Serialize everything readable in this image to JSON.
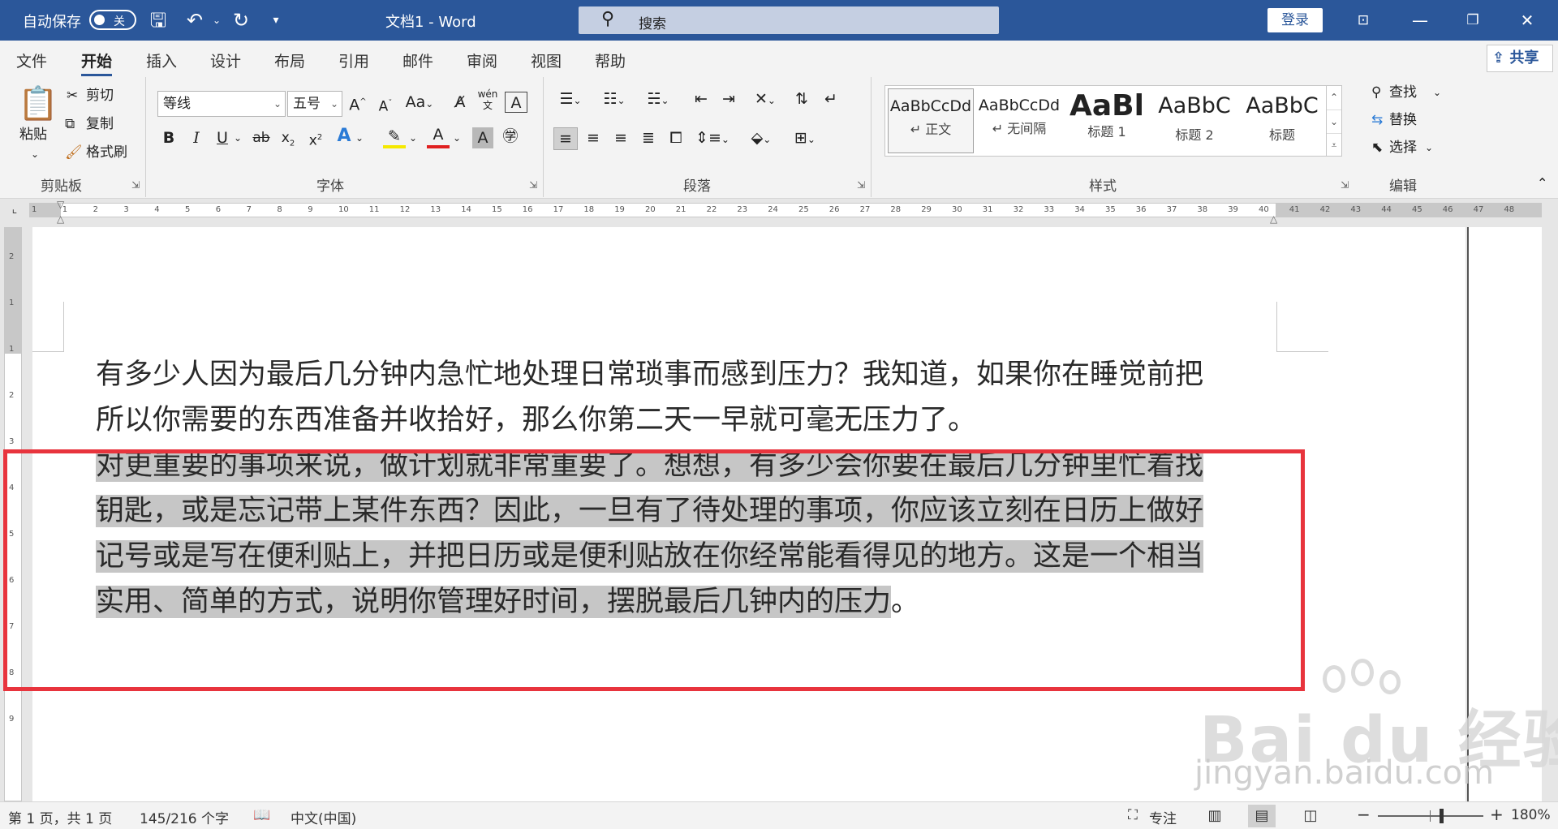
{
  "titlebar": {
    "autosave_label": "自动保存",
    "autosave_state": "关",
    "doc_title": "文档1  -  Word",
    "search_placeholder": "搜索",
    "login_label": "登录",
    "bg_color": "#2b579a"
  },
  "tabs": [
    "文件",
    "开始",
    "插入",
    "设计",
    "布局",
    "引用",
    "邮件",
    "审阅",
    "视图",
    "帮助"
  ],
  "active_tab": "开始",
  "share_label": "共享",
  "clipboard": {
    "paste": "粘贴",
    "cut": "剪切",
    "copy": "复制",
    "format_painter": "格式刷",
    "group": "剪贴板"
  },
  "font": {
    "name": "等线",
    "size": "五号",
    "group": "字体"
  },
  "paragraph": {
    "group": "段落"
  },
  "styles": {
    "group": "样式",
    "items": [
      {
        "preview": "AaBbCcDd",
        "name": "↵ 正文"
      },
      {
        "preview": "AaBbCcDd",
        "name": "↵ 无间隔"
      },
      {
        "preview": "AaBl",
        "name": "标题 1"
      },
      {
        "preview": "AaBbC",
        "name": "标题 2"
      },
      {
        "preview": "AaBbC",
        "name": "标题"
      }
    ]
  },
  "editing": {
    "find": "查找",
    "replace": "替换",
    "select": "选择",
    "group": "编辑"
  },
  "ruler_numbers": [
    1,
    1,
    2,
    3,
    4,
    5,
    6,
    7,
    8,
    9,
    10,
    11,
    12,
    13,
    14,
    15,
    16,
    17,
    18,
    19,
    20,
    21,
    22,
    23,
    24,
    25,
    26,
    27,
    28,
    29,
    30,
    31,
    32,
    33,
    34,
    35,
    36,
    37,
    38,
    39,
    40,
    41,
    42,
    43,
    44,
    45,
    46,
    47,
    48
  ],
  "vruler_numbers": [
    2,
    1,
    1,
    2,
    3,
    4,
    5,
    6,
    7,
    8,
    9
  ],
  "document": {
    "para1": [
      "有多少人因为最后几分钟内急忙地处理日常琐事而感到压力？我知道，如果你在睡觉前把",
      "所以你需要的东西准备并收拾好，那么你第二天一早就可毫无压力了。"
    ],
    "para2": [
      "对更重要的事项来说，做计划就非常重要了。想想，有多少会你要在最后几分钟里忙着找",
      "钥匙，或是忘记带上某件东西？因此，一旦有了待处理的事项，你应该立刻在日历上做好",
      "记号或是写在便利贴上，并把日历或是便利贴放在你经常能看得见的地方。这是一个相当",
      "实用、简单的方式，说明你管理好时间，摆脱最后几钟内的压力"
    ],
    "para2_end": "。",
    "highlight_color": "#c6c6c6",
    "annotation_color": "#e8343d"
  },
  "watermark": {
    "brand": "Bai  du 经验",
    "url": "jingyan.baidu.com"
  },
  "statusbar": {
    "page": "第 1 页，共 1 页",
    "words": "145/216 个字",
    "language": "中文(中国)",
    "focus": "专注",
    "zoom_minus": "−",
    "zoom_plus": "+",
    "zoom": "180%",
    "zoom_level": 0.6
  }
}
